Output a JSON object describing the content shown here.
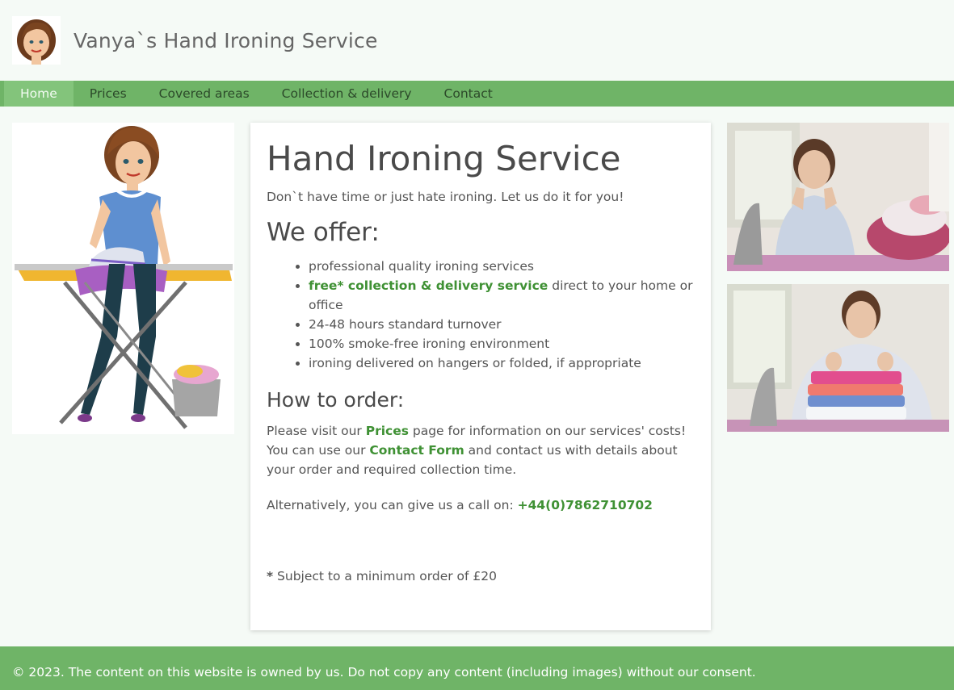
{
  "header": {
    "site_title": "Vanya`s Hand Ironing Service",
    "logo_icon": "woman-avatar-icon"
  },
  "nav": {
    "items": [
      {
        "label": "Home",
        "active": true
      },
      {
        "label": "Prices",
        "active": false
      },
      {
        "label": "Covered areas",
        "active": false
      },
      {
        "label": "Collection & delivery",
        "active": false
      },
      {
        "label": "Contact",
        "active": false
      }
    ]
  },
  "main": {
    "title": "Hand Ironing Service",
    "intro": "Don`t have time or just hate ironing. Let us do it for you!",
    "offer_heading": "We offer:",
    "offer_items": {
      "item1": "professional quality ironing services",
      "item2_link": "free* collection & delivery service",
      "item2_rest": " direct to your home or office",
      "item3": "24-48 hours standard turnover",
      "item4": "100% smoke-free ironing environment",
      "item5": "ironing delivered on hangers or folded, if appropriate"
    },
    "order_heading": "How to order:",
    "order_p1": {
      "text1": "Please visit our ",
      "link1": "Prices",
      "text2": " page for information on our services' costs! You can use our ",
      "link2": "Contact Form",
      "text3": " and contact us with details about your order and required collection time."
    },
    "call": {
      "text": "Alternatively, you can give us a call on: ",
      "phone": "+44(0)7862710702"
    },
    "note": {
      "star": "*",
      "text": " Subject to a minimum order of £20"
    }
  },
  "footer": {
    "text": "© 2023. The content on this website is owned by us. Do not copy any content (including images) without our consent."
  },
  "colors": {
    "nav_bg": "#6fb467",
    "nav_active": "#83c47b",
    "link_green": "#3f9134",
    "page_bg": "#f5faf6"
  }
}
